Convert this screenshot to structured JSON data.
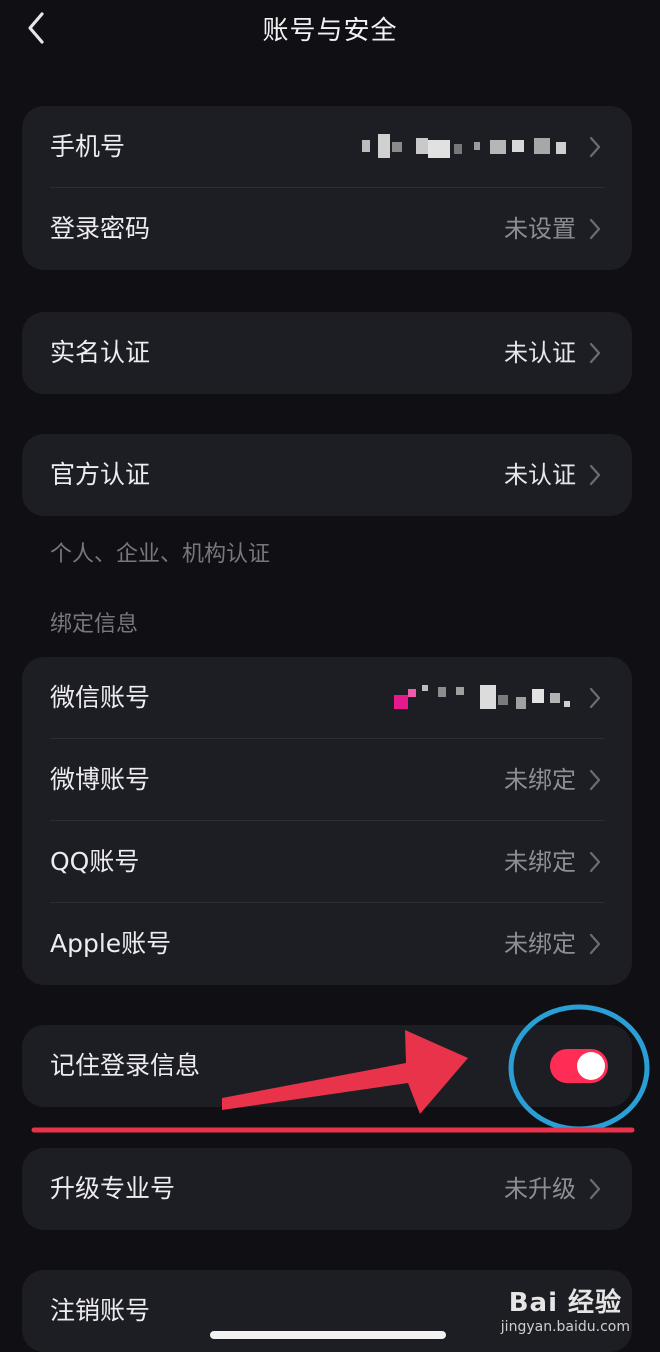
{
  "header": {
    "title": "账号与安全"
  },
  "groups": {
    "account": {
      "phone": {
        "label": "手机号",
        "value": ""
      },
      "password": {
        "label": "登录密码",
        "value": "未设置"
      }
    },
    "realname": {
      "label": "实名认证",
      "value": "未认证"
    },
    "official": {
      "label": "官方认证",
      "value": "未认证"
    }
  },
  "notes": {
    "official_hint": "个人、企业、机构认证",
    "binding_title": "绑定信息"
  },
  "binding": {
    "wechat": {
      "label": "微信账号",
      "value": ""
    },
    "weibo": {
      "label": "微博账号",
      "value": "未绑定"
    },
    "qq": {
      "label": "QQ账号",
      "value": "未绑定"
    },
    "apple": {
      "label": "Apple账号",
      "value": "未绑定"
    }
  },
  "remember": {
    "label": "记住登录信息",
    "enabled": true
  },
  "upgrade": {
    "label": "升级专业号",
    "value": "未升级"
  },
  "cancel": {
    "label": "注销账号"
  },
  "watermark": {
    "brand": "Bai 经验",
    "url": "jingyan.baidu.com"
  },
  "colors": {
    "accent": "#ff2d55",
    "annotation": "#e8334a",
    "circle": "#2a9fd6",
    "background": "#0f0f14",
    "card": "#1d1d24"
  },
  "icons": {
    "back": "chevron-left-icon",
    "row": "chevron-right-icon"
  }
}
